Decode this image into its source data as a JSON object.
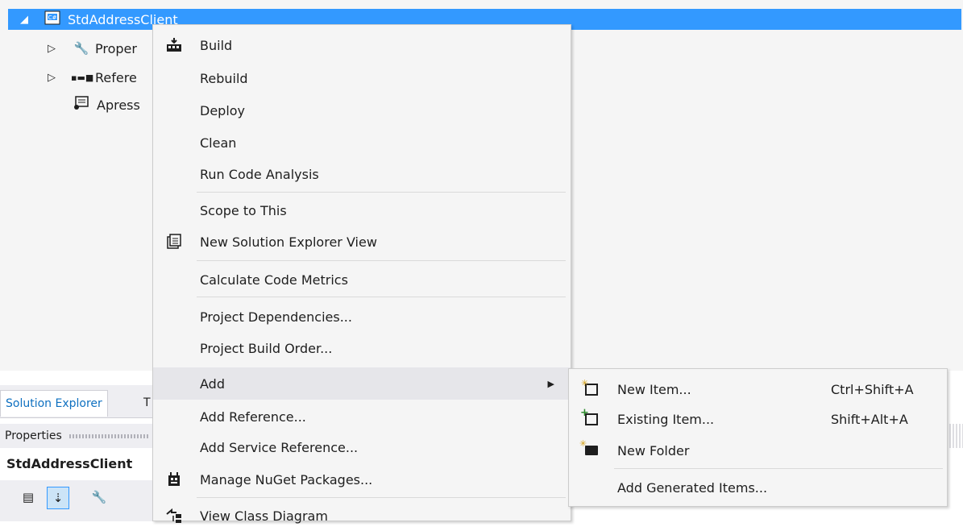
{
  "tree": {
    "project": "StdAddressClient",
    "items": [
      {
        "label": "Proper",
        "icon": "wrench-icon"
      },
      {
        "label": "Refere",
        "icon": "references-icon"
      },
      {
        "label": "Apress",
        "icon": "config-file-icon"
      }
    ]
  },
  "tabs": {
    "active": "Solution Explorer",
    "other": "T"
  },
  "properties": {
    "title": "Properties",
    "object": "StdAddressClient"
  },
  "context_menu": {
    "items": [
      {
        "label": "Build",
        "icon": "build-icon"
      },
      {
        "label": "Rebuild"
      },
      {
        "label": "Deploy"
      },
      {
        "label": "Clean"
      },
      {
        "label": "Run Code Analysis"
      },
      {
        "label": "Scope to This"
      },
      {
        "label": "New Solution Explorer View",
        "icon": "new-view-icon"
      },
      {
        "label": "Calculate Code Metrics"
      },
      {
        "label": "Project Dependencies..."
      },
      {
        "label": "Project Build Order..."
      },
      {
        "label": "Add",
        "has_submenu": true
      },
      {
        "label": "Add Reference..."
      },
      {
        "label": "Add Service Reference..."
      },
      {
        "label": "Manage NuGet Packages...",
        "icon": "nuget-icon"
      },
      {
        "label": "View Class Diagram",
        "icon": "class-diagram-icon"
      }
    ]
  },
  "add_submenu": {
    "items": [
      {
        "label": "New Item...",
        "shortcut": "Ctrl+Shift+A",
        "icon": "new-item-icon"
      },
      {
        "label": "Existing Item...",
        "shortcut": "Shift+Alt+A",
        "icon": "existing-item-icon"
      },
      {
        "label": "New Folder",
        "shortcut": "",
        "icon": "new-folder-icon"
      },
      {
        "label": "Add Generated Items...",
        "shortcut": ""
      }
    ]
  },
  "colors": {
    "selection": "#3399ff",
    "menu_bg": "#f5f5f5",
    "hover": "#e6e6ea"
  }
}
